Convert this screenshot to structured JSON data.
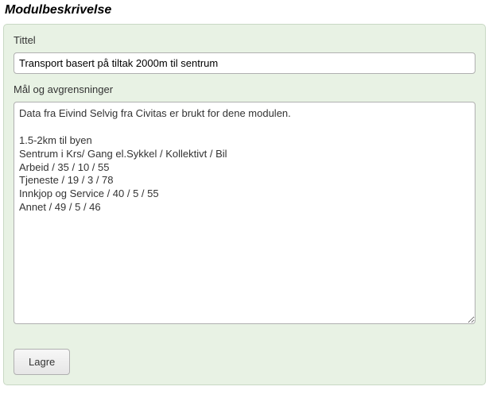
{
  "module": {
    "heading": "Modulbeskrivelse",
    "title_label": "Tittel",
    "title_value": "Transport basert på tiltak 2000m til sentrum",
    "goals_label": "Mål og avgrensninger",
    "goals_value": "Data fra Eivind Selvig fra Civitas er brukt for dene modulen.\n\n1.5-2km til byen\nSentrum i Krs/ Gang el.Sykkel / Kollektivt / Bil\nArbeid / 35 / 10 / 55\nTjeneste / 19 / 3 / 78\nInnkjop og Service / 40 / 5 / 55\nAnnet / 49 / 5 / 46",
    "save_label": "Lagre"
  }
}
